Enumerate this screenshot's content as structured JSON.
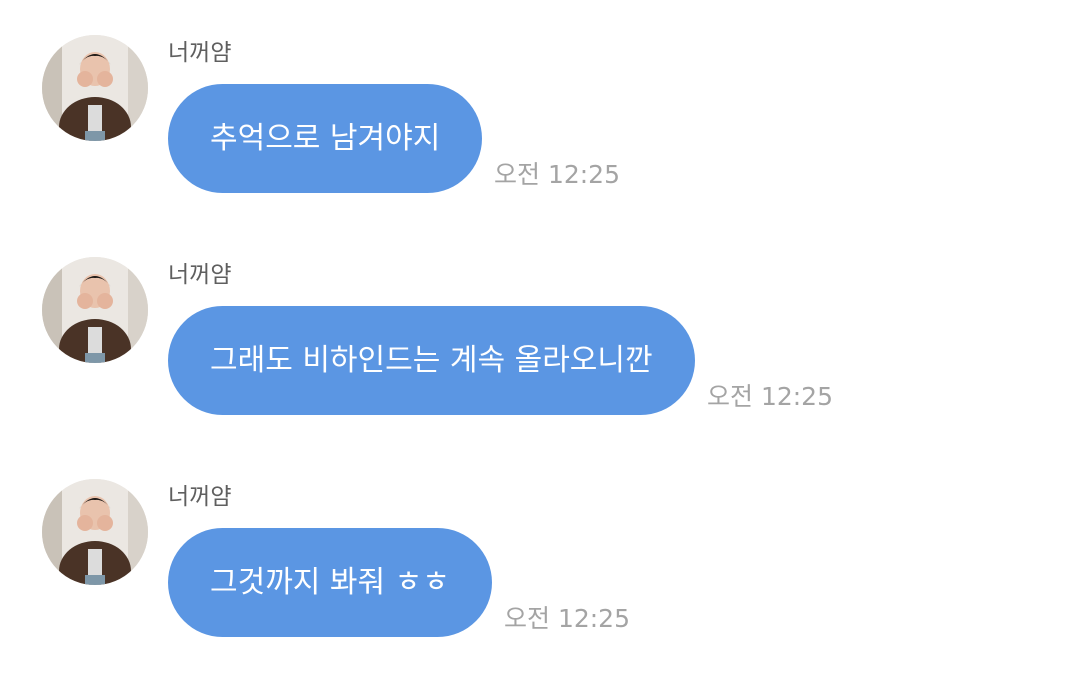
{
  "messages": [
    {
      "sender": "너꺼얌",
      "text": "추억으로 남겨야지",
      "time": "오전 12:25"
    },
    {
      "sender": "너꺼얌",
      "text": "그래도 비하인드는 계속 올라오니깐",
      "time": "오전 12:25"
    },
    {
      "sender": "너꺼얌",
      "text": "그것까지 봐줘 ㅎㅎ",
      "time": "오전 12:25"
    }
  ],
  "colors": {
    "bubble": "#5b96e3",
    "bubble_text": "#ffffff",
    "sender_text": "#5f5f5f",
    "time_text": "#a4a4a4",
    "background": "#ffffff"
  }
}
